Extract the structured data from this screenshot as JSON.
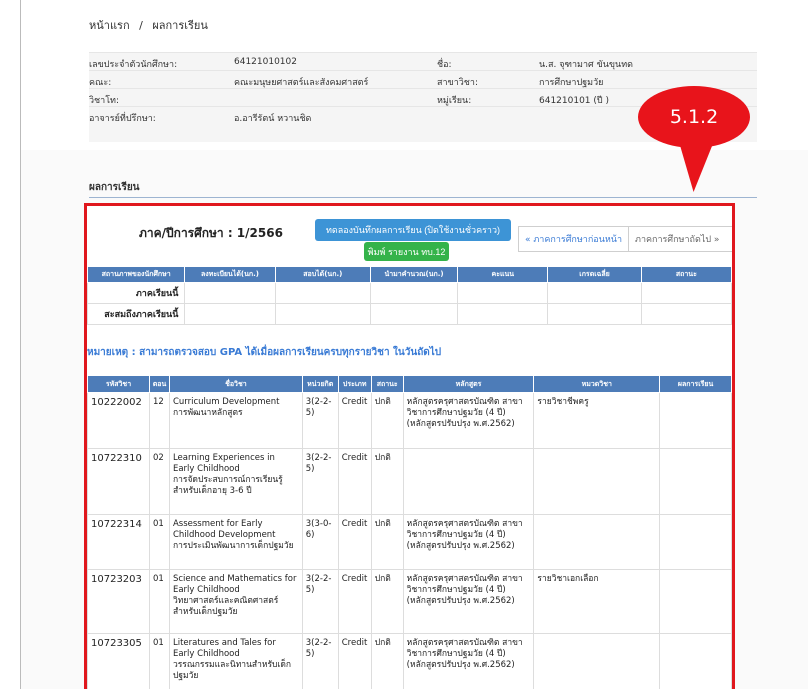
{
  "breadcrumb": {
    "home": "หน้าแรก",
    "sep": "/",
    "current": "ผลการเรียน"
  },
  "info": {
    "student_id_label": "เลขประจำตัวนักศึกษา:",
    "student_id": "64121010102",
    "name_label": "ชื่อ:",
    "name": "น.ส. จุฑามาศ ขันขุนทด",
    "faculty_label": "คณะ:",
    "faculty": "คณะมนุษยศาสตร์และสังคมศาสตร์",
    "major_label": "สาขาวิชา:",
    "major": "การศึกษาปฐมวัย",
    "minor_label": "วิชาโท:",
    "minor": "",
    "group_label": "หมู่เรียน:",
    "group": "641210101 (ปี )",
    "advisor_label": "อาจารย์ที่ปรึกษา:",
    "advisor": "อ.อารีรัตน์ หวานชิด"
  },
  "section_title": "ผลการเรียน",
  "term": {
    "label": "ภาค/ปีการศึกษา : 1/2566"
  },
  "buttons": {
    "record": "ทดลองบันทึกผลการเรียน (ปิดใช้งานชั่วคราว)",
    "print": "พิมพ์ รายงาน ทบ.12",
    "prev_term": "« ภาคการศึกษาก่อนหน้า",
    "next_term": "ภาคการศึกษาถัดไป »"
  },
  "summary": {
    "headers": [
      "สถานภาพของนักศึกษา",
      "ลงทะเบียนได้(นก.)",
      "สอบได้(นก.)",
      "นำมาคำนวณ(นก.)",
      "คะแนน",
      "เกรดเฉลี่ย",
      "สถานะ"
    ],
    "rows": [
      "ภาคเรียนนี้",
      "สะสมถึงภาคเรียนนี้"
    ]
  },
  "note": "หมายเหตุ : สามารถตรวจสอบ GPA ได้เมื่อผลการเรียนครบทุกรายวิชา ในวันถัดไป",
  "courses": {
    "headers": [
      "รหัสวิชา",
      "ตอน",
      "ชื่อวิชา",
      "หน่วยกิต",
      "ประเภท",
      "สถานะ",
      "หลักสูตร",
      "หมวดวิชา",
      "ผลการเรียน"
    ],
    "rows": [
      {
        "code": "10222002",
        "sec": "12",
        "name_en": "Curriculum Development",
        "name_th": "การพัฒนาหลักสูตร",
        "credit": "3(2-2-5)",
        "type": "Credit",
        "status": "ปกติ",
        "program": "หลักสูตรครุศาสตรบัณฑิต สาขาวิชาการศึกษาปฐมวัย (4 ปี) (หลักสูตรปรับปรุง พ.ศ.2562)",
        "category": "รายวิชาชีพครู",
        "grade": ""
      },
      {
        "code": "10722310",
        "sec": "02",
        "name_en": "Learning Experiences in Early Childhood",
        "name_th": "การจัดประสบการณ์การเรียนรู้สำหรับเด็กอายุ 3-6 ปี",
        "credit": "3(2-2-5)",
        "type": "Credit",
        "status": "ปกติ",
        "program": "",
        "category": "",
        "grade": ""
      },
      {
        "code": "10722314",
        "sec": "01",
        "name_en": "Assessment for Early Childhood Development",
        "name_th": "การประเมินพัฒนาการเด็กปฐมวัย",
        "credit": "3(3-0-6)",
        "type": "Credit",
        "status": "ปกติ",
        "program": "หลักสูตรครุศาสตรบัณฑิต สาขาวิชาการศึกษาปฐมวัย (4 ปี) (หลักสูตรปรับปรุง พ.ศ.2562)",
        "category": "",
        "grade": ""
      },
      {
        "code": "10723203",
        "sec": "01",
        "name_en": "Science and Mathematics for Early Childhood",
        "name_th": "วิทยาศาสตร์และคณิตศาสตร์สำหรับเด็กปฐมวัย",
        "credit": "3(2-2-5)",
        "type": "Credit",
        "status": "ปกติ",
        "program": "หลักสูตรครุศาสตรบัณฑิต สาขาวิชาการศึกษาปฐมวัย (4 ปี) (หลักสูตรปรับปรุง พ.ศ.2562)",
        "category": "รายวิชาเอกเลือก",
        "grade": ""
      },
      {
        "code": "10723305",
        "sec": "01",
        "name_en": "Literatures and Tales for Early Childhood",
        "name_th": "วรรณกรรมและนิทานสำหรับเด็กปฐมวัย",
        "credit": "3(2-2-5)",
        "type": "Credit",
        "status": "ปกติ",
        "program": "หลักสูตรครุศาสตรบัณฑิต สาขาวิชาการศึกษาปฐมวัย (4 ปี) (หลักสูตรปรับปรุง พ.ศ.2562)",
        "category": "",
        "grade": ""
      }
    ]
  },
  "callout": {
    "label": "5.1.2",
    "color": "#e8141b"
  }
}
